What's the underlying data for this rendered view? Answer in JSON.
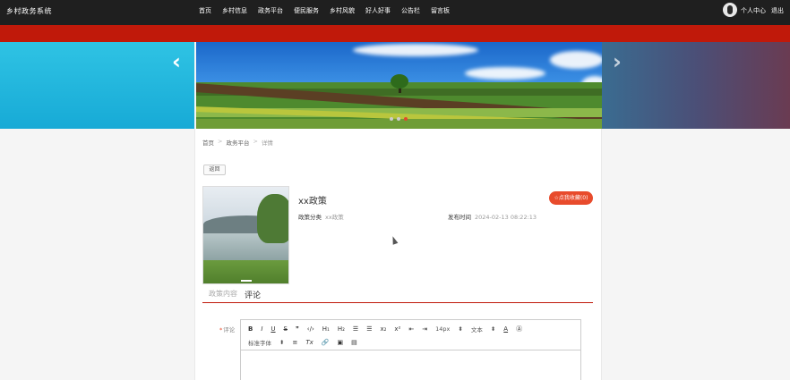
{
  "header": {
    "brand": "乡村政务系统",
    "nav": [
      "首页",
      "乡村信息",
      "政务平台",
      "便民服务",
      "乡村风貌",
      "好人好事",
      "公告栏",
      "留言板"
    ],
    "user_center": "个人中心",
    "logout": "退出"
  },
  "banner": {
    "prev_icon": "chevron-left-icon",
    "next_icon": "chevron-right-icon",
    "slide_count": 3,
    "active_slide": 3
  },
  "breadcrumb": {
    "home": "首页",
    "section": "政务平台",
    "current": "详情"
  },
  "back_label": "返回",
  "policy": {
    "title": "xx政策",
    "favorite_label": "☆点我收藏(0)",
    "category_label": "政策分类",
    "category_value": "xx政策",
    "publish_label": "发布时间",
    "publish_value": "2024-02-13 08:22:13"
  },
  "tabs": {
    "content": "政策内容",
    "comment": "评论"
  },
  "comment_form": {
    "required_mark": "*",
    "label": "评论"
  },
  "editor_toolbar": {
    "row1": [
      "B",
      "I",
      "U",
      "S",
      "❞",
      "‹/›",
      "H₁",
      "H₂",
      "☰",
      "☰",
      "x₂",
      "x²",
      "⇤",
      "⇥",
      "14px",
      "⬍",
      "文本",
      "⬍",
      "A",
      "Ⓐ"
    ],
    "row2": [
      "标准字体",
      "⬍",
      "≡",
      "Tx",
      "🔗",
      "▣",
      "▤"
    ]
  },
  "colors": {
    "topbar": "#1f1f1f",
    "accent_red": "#c0190a",
    "favorite_button": "#e84b2c"
  }
}
